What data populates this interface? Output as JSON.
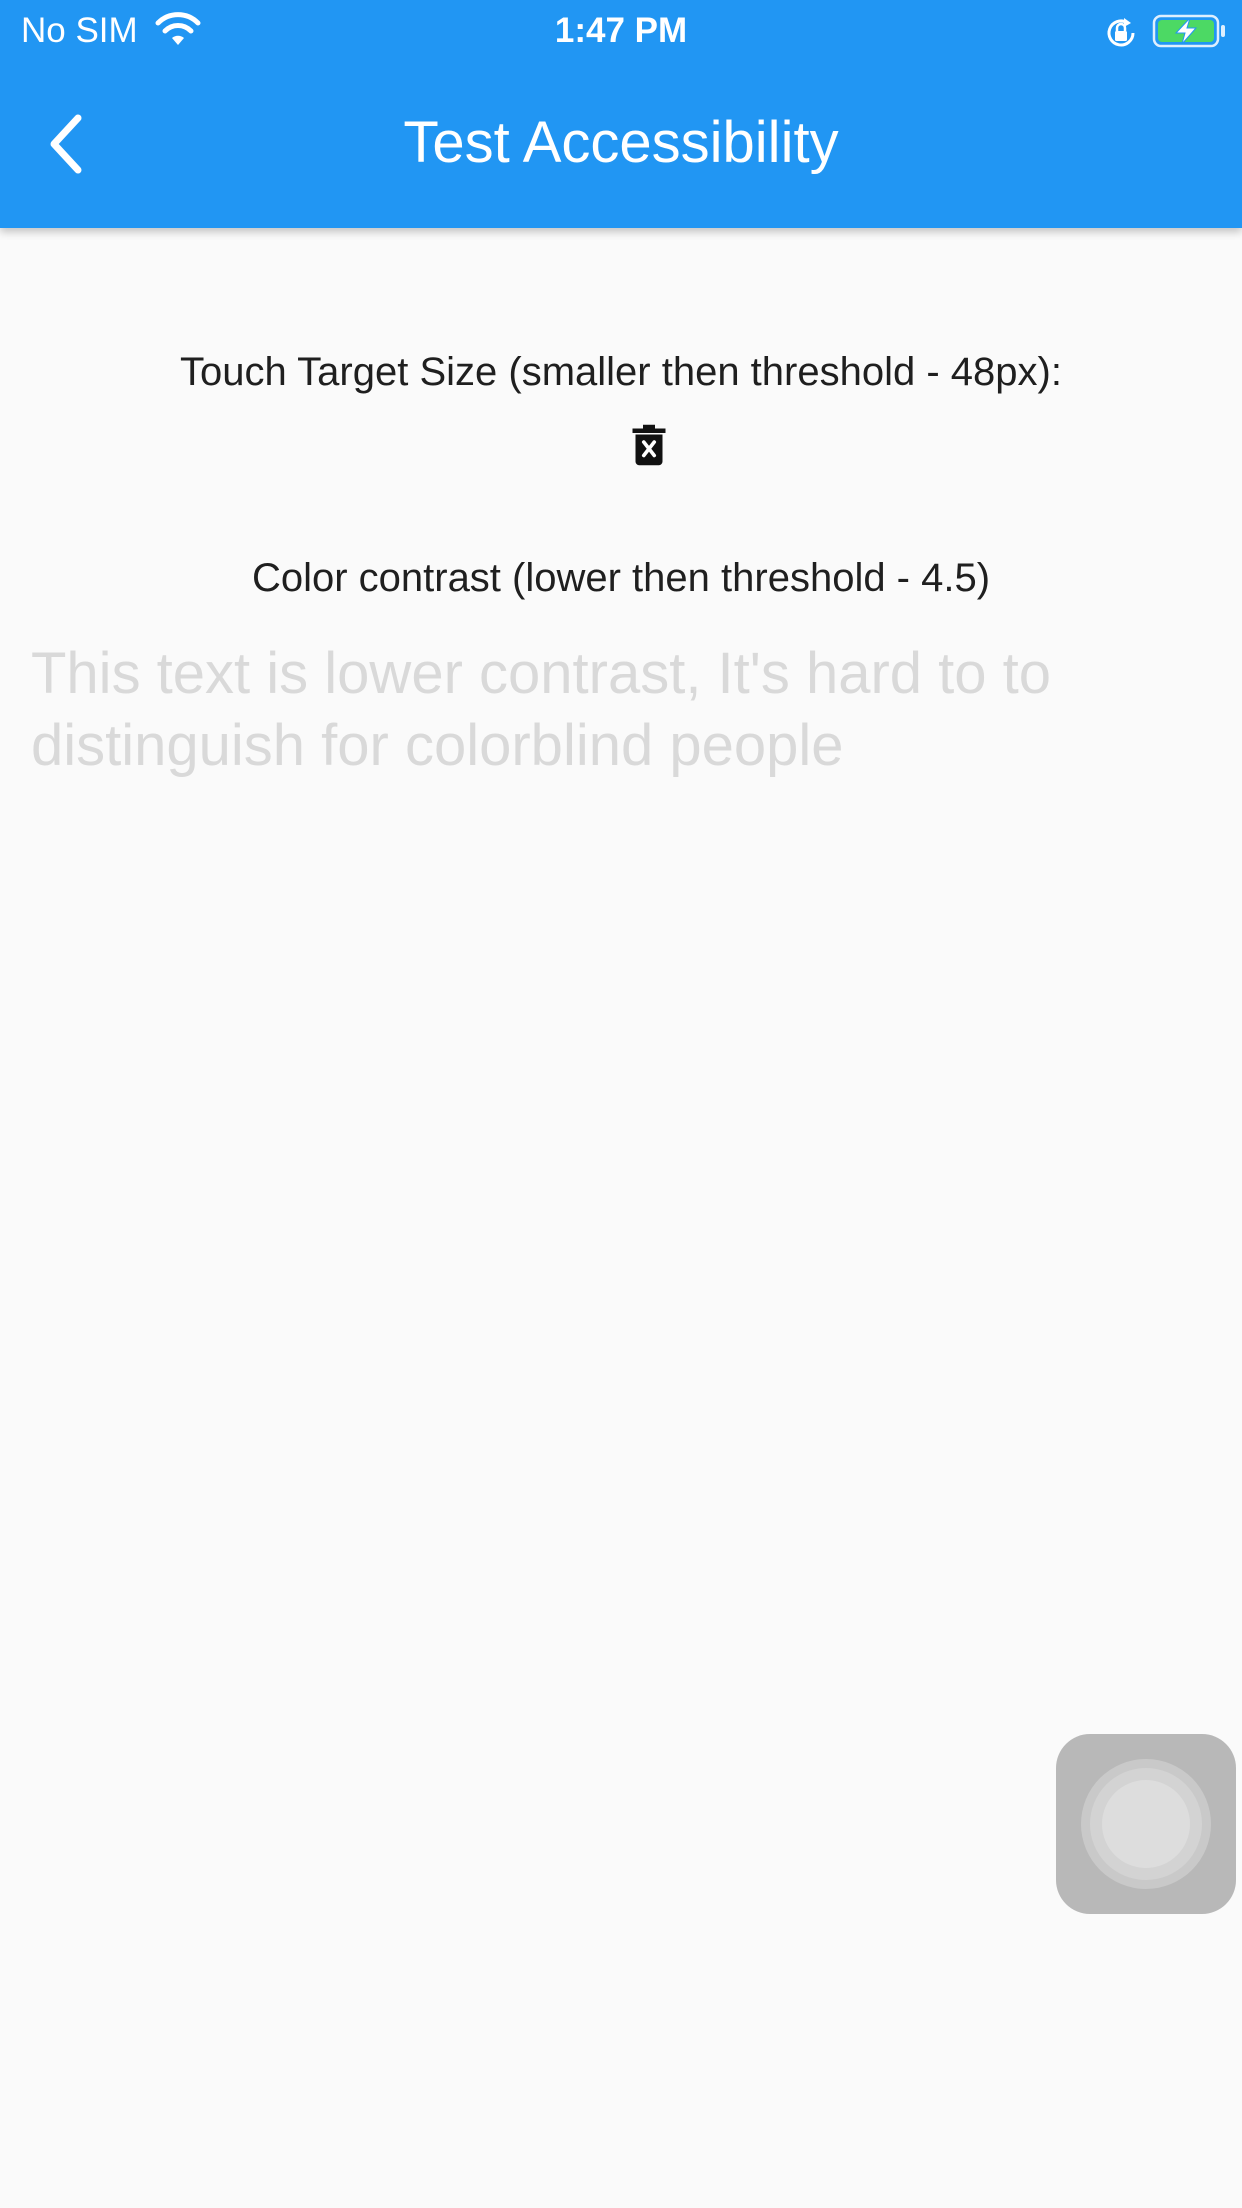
{
  "status_bar": {
    "carrier": "No SIM",
    "time": "1:47 PM",
    "icons": [
      "wifi-icon",
      "rotation-lock-icon",
      "battery-charging-icon"
    ]
  },
  "app_bar": {
    "title": "Test Accessibility",
    "back_icon": "chevron-left-icon",
    "color": "#2196f3"
  },
  "main": {
    "touch_target_label": "Touch Target Size (smaller then threshold - 48px):",
    "delete_icon": "delete-forever-icon",
    "contrast_label": "Color contrast (lower then threshold - 4.5)",
    "low_contrast_text": "This text is lower contrast, It's hard to to distinguish for colorblind people",
    "low_contrast_color": "#d9d9d9"
  },
  "overlay": {
    "assistive_touch_icon": "assistive-touch-icon"
  }
}
